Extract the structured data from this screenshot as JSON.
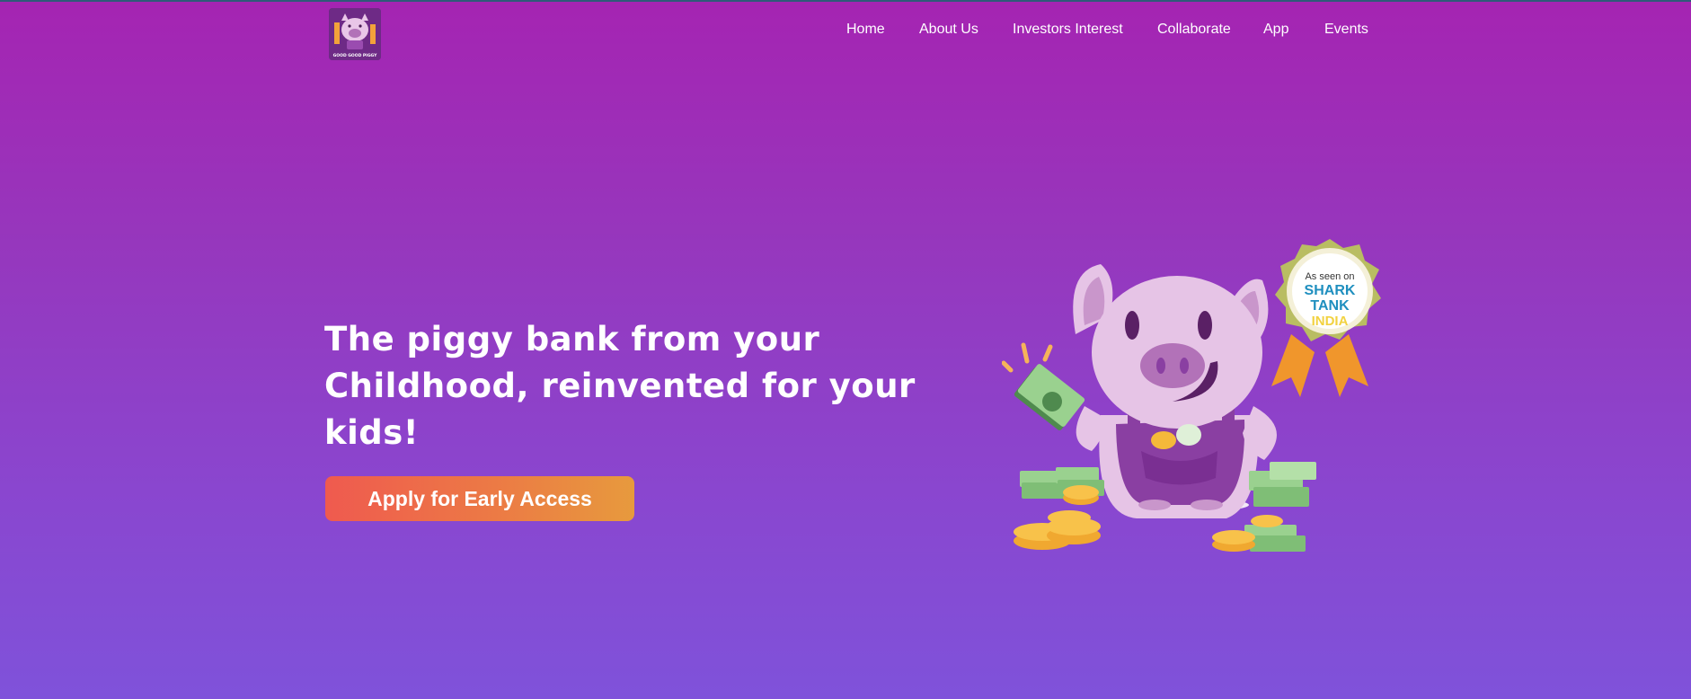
{
  "brand": {
    "logo_text": "GOOD GOOD PIGGY"
  },
  "nav": {
    "items": [
      {
        "label": "Home"
      },
      {
        "label": "About Us"
      },
      {
        "label": "Investors Interest"
      },
      {
        "label": "Collaborate"
      },
      {
        "label": "App"
      },
      {
        "label": "Events"
      }
    ]
  },
  "hero": {
    "headline": "The piggy bank from your Childhood, reinvented for your kids!",
    "cta_label": "Apply for Early Access"
  },
  "badge": {
    "line1": "As seen on",
    "line2": "SHARK",
    "line3": "TANK",
    "line4": "INDIA"
  },
  "colors": {
    "background_top": "#a524b2",
    "background_bottom": "#7f52da",
    "cta_start": "#ef5a4f",
    "cta_end": "#e79a3d",
    "pig": "#e6c4e6",
    "overalls": "#8a3fa2"
  },
  "icons": [
    "pig-logo-icon",
    "piggy-mascot-icon",
    "cash-stack-icon",
    "coin-stack-icon",
    "award-badge-icon"
  ]
}
